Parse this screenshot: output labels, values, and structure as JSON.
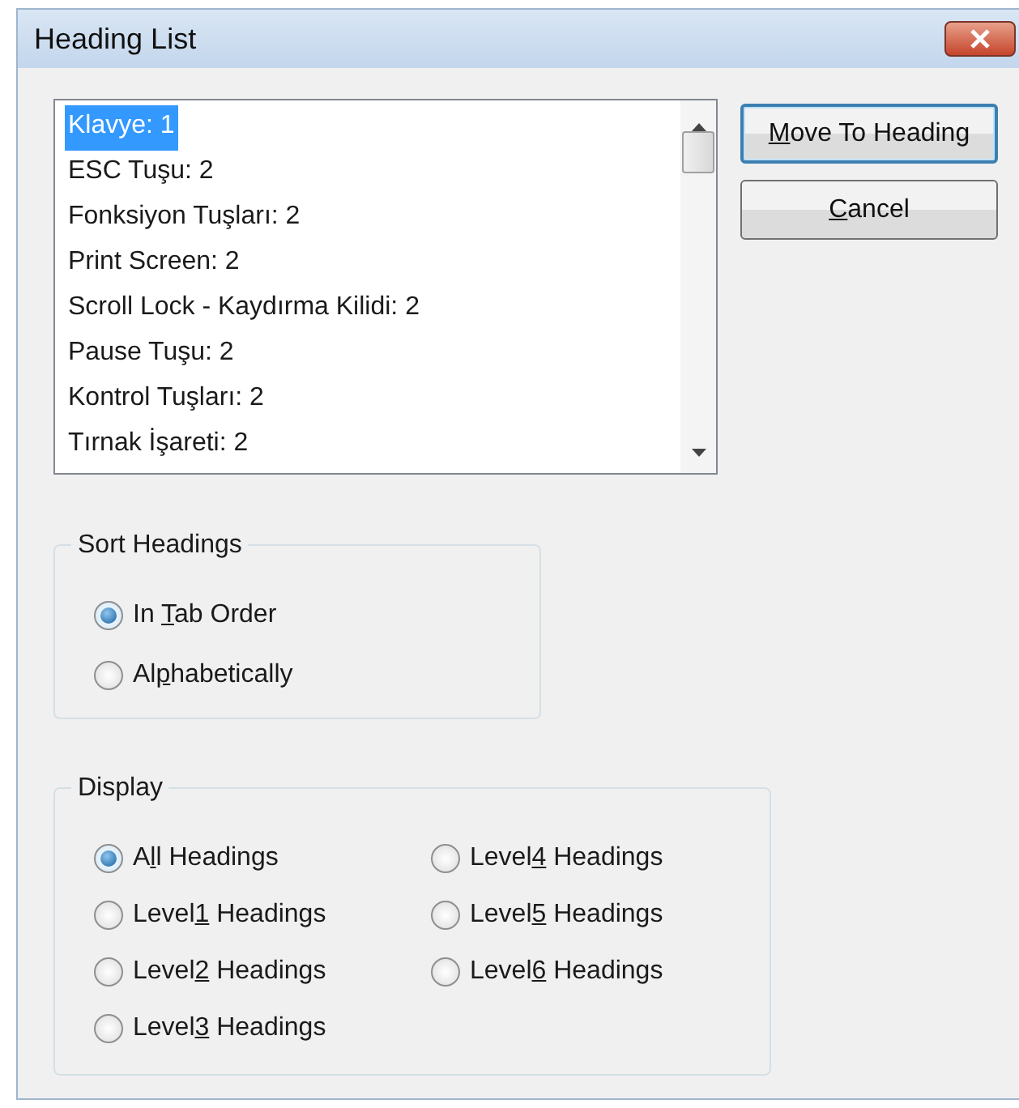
{
  "window": {
    "title": "Heading List"
  },
  "headings": [
    {
      "text": "Klavye: 1",
      "selected": true
    },
    {
      "text": "ESC Tuşu: 2",
      "selected": false
    },
    {
      "text": "Fonksiyon Tuşları: 2",
      "selected": false
    },
    {
      "text": "Print Screen: 2",
      "selected": false
    },
    {
      "text": "Scroll Lock - Kaydırma Kilidi: 2",
      "selected": false
    },
    {
      "text": "Pause Tuşu: 2",
      "selected": false
    },
    {
      "text": "Kontrol Tuşları: 2",
      "selected": false
    },
    {
      "text": "Tırnak İşareti: 2",
      "selected": false
    }
  ],
  "buttons": [
    {
      "mnemonic": "M",
      "label_rest": "ove To Heading",
      "default": true
    },
    {
      "mnemonic": "C",
      "label_rest": "ancel",
      "default": false
    }
  ],
  "sort_headings": {
    "title": "Sort Headings",
    "options": [
      {
        "label_start": "In ",
        "mnemonic": "T",
        "label_rest": "ab Order",
        "selected": true
      },
      {
        "label_start": "Al",
        "mnemonic": "p",
        "label_rest": "habetically",
        "selected": false
      }
    ]
  },
  "display": {
    "title": "Display",
    "options": [
      {
        "label_start": "A",
        "mnemonic": "l",
        "label_rest": "l Headings",
        "selected": true
      },
      {
        "label_start": "Level",
        "mnemonic": "1",
        "label_rest": " Headings",
        "selected": false
      },
      {
        "label_start": "Level",
        "mnemonic": "2",
        "label_rest": " Headings",
        "selected": false
      },
      {
        "label_start": "Level",
        "mnemonic": "3",
        "label_rest": " Headings",
        "selected": false
      },
      {
        "label_start": "Level",
        "mnemonic": "4",
        "label_rest": " Headings",
        "selected": false
      },
      {
        "label_start": "Level",
        "mnemonic": "5",
        "label_rest": " Headings",
        "selected": false
      },
      {
        "label_start": "Level",
        "mnemonic": "6",
        "label_rest": " Headings",
        "selected": false
      }
    ]
  }
}
